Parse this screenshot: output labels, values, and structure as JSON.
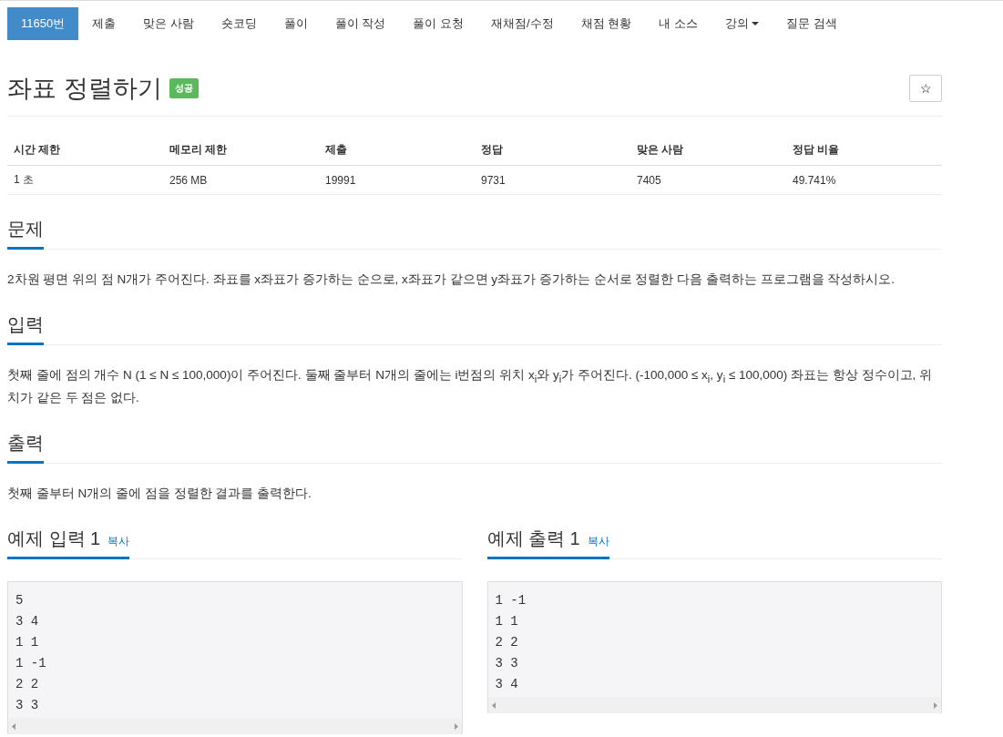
{
  "nav": [
    {
      "label": "11650번",
      "selected": true,
      "kind": "link"
    },
    {
      "label": "제출",
      "selected": false,
      "kind": "link"
    },
    {
      "label": "맞은 사람",
      "selected": false,
      "kind": "link"
    },
    {
      "label": "숏코딩",
      "selected": false,
      "kind": "link"
    },
    {
      "label": "풀이",
      "selected": false,
      "kind": "link"
    },
    {
      "label": "풀이 작성",
      "selected": false,
      "kind": "link"
    },
    {
      "label": "풀이 요청",
      "selected": false,
      "kind": "link"
    },
    {
      "label": "재채점/수정",
      "selected": false,
      "kind": "link"
    },
    {
      "label": "채점 현황",
      "selected": false,
      "kind": "link"
    },
    {
      "label": "내 소스",
      "selected": false,
      "kind": "link"
    },
    {
      "label": "강의",
      "selected": false,
      "kind": "dropdown"
    },
    {
      "label": "질문 검색",
      "selected": false,
      "kind": "link"
    }
  ],
  "problem": {
    "title": "좌표 정렬하기",
    "badge": "성공",
    "star_button": "☆"
  },
  "info_table": {
    "columns": [
      "시간 제한",
      "메모리 제한",
      "제출",
      "정답",
      "맞은 사람",
      "정답 비율"
    ],
    "rows": [
      [
        "1 초",
        "256 MB",
        "19991",
        "9731",
        "7405",
        "49.741%"
      ]
    ]
  },
  "sections": [
    {
      "heading": "문제",
      "text": "2차원 평면 위의 점 N개가 주어진다. 좌표를 x좌표가 증가하는 순으로, x좌표가 같으면 y좌표가 증가하는 순서로 정렬한 다음 출력하는 프로그램을 작성하시오."
    },
    {
      "heading": "입력",
      "text": "첫째 줄에 점의 개수 N (1 ≤ N ≤ 100,000)이 주어진다. 둘째 줄부터 N개의 줄에는 i번점의 위치 x$_{i}$와 y$_{i}$가 주어진다. (-100,000 ≤ x$_{i}$, y$_{i}$ ≤ 100,000) 좌표는 항상 정수이고, 위치가 같은 두 점은 없다."
    },
    {
      "heading": "출력",
      "text": "첫째 줄부터 N개의 줄에 점을 정렬한 결과를 출력한다."
    }
  ],
  "samples": [
    {
      "heading": "예제 입력 1",
      "copy": "복사",
      "lines": [
        "5",
        "3 4",
        "1 1",
        "1 -1",
        "2 2",
        "3 3"
      ]
    },
    {
      "heading": "예제 출력 1",
      "copy": "복사",
      "lines": [
        "1 -1",
        "1 1",
        "2 2",
        "3 3",
        "3 4"
      ]
    }
  ]
}
